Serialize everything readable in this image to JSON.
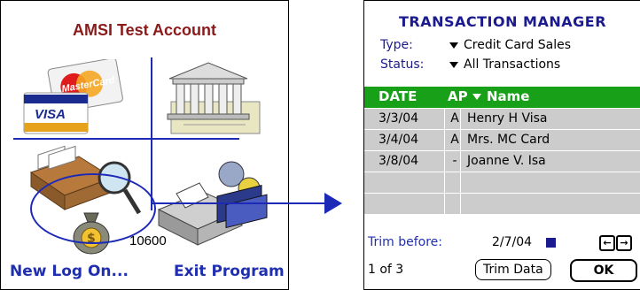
{
  "left": {
    "title": "AMSI Test Account",
    "code": "10600",
    "new_logon": "New Log On...",
    "exit": "Exit Program",
    "card_mastercard": "MasterCard",
    "card_visa": "VISA"
  },
  "right": {
    "title": "TRANSACTION MANAGER",
    "type_label": "Type:",
    "type_value": "Credit Card Sales",
    "status_label": "Status:",
    "status_value": "All Transactions",
    "columns": {
      "date": "DATE",
      "ap": "AP",
      "name": "Name"
    },
    "rows": [
      {
        "date": "3/3/04",
        "ap": "A",
        "name": "Henry H Visa"
      },
      {
        "date": "3/4/04",
        "ap": "A",
        "name": "Mrs. MC Card"
      },
      {
        "date": "3/8/04",
        "ap": "-",
        "name": "Joanne V. Isa"
      },
      {
        "date": "",
        "ap": "",
        "name": ""
      },
      {
        "date": "",
        "ap": "",
        "name": ""
      }
    ],
    "trim_before_label": "Trim before:",
    "trim_date": "2/7/04",
    "page": "1 of 3",
    "trim_button": "Trim Data",
    "ok_button": "OK"
  },
  "colors": {
    "accent": "#1d2ab8",
    "title_red": "#8b1a1a",
    "header_green": "#19a019",
    "row_gray": "#cccccc"
  }
}
